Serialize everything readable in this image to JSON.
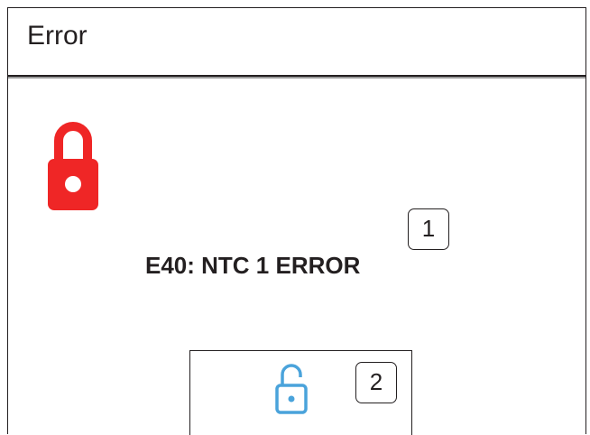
{
  "window": {
    "title": "Error"
  },
  "error": {
    "message": "E40: NTC 1 ERROR"
  },
  "callouts": {
    "one": "1",
    "two": "2"
  },
  "icons": {
    "locked": "lock-closed",
    "unlock": "lock-open"
  },
  "colors": {
    "lock_red": "#ef2626",
    "unlock_blue": "#4aa3db",
    "text": "#231f20"
  }
}
